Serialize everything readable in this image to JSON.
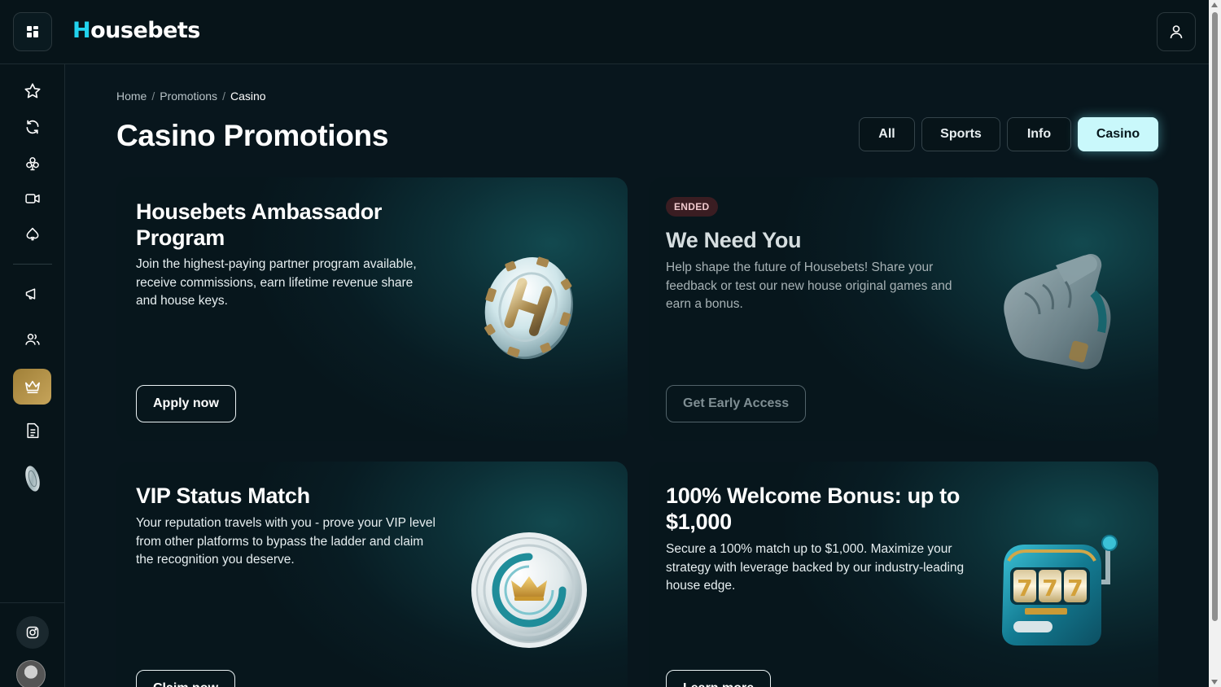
{
  "app": {
    "logo_first": "H",
    "logo_rest": "ousebets"
  },
  "breadcrumb": {
    "home": "Home",
    "sep1": "/",
    "promotions": "Promotions",
    "sep2": "/",
    "current": "Casino"
  },
  "page": {
    "title": "Casino Promotions"
  },
  "filters": [
    {
      "label": "All",
      "active": false
    },
    {
      "label": "Sports",
      "active": false
    },
    {
      "label": "Info",
      "active": false
    },
    {
      "label": "Casino",
      "active": true
    }
  ],
  "cards": [
    {
      "title": "Housebets Ambassador Program",
      "description": "Join the highest-paying partner program available, receive commissions, earn lifetime revenue share and house keys.",
      "button": "Apply now",
      "icon": "poker-chip-h-icon"
    },
    {
      "badge": "ENDED",
      "title": "We Need You",
      "description": "Help shape the future of Housebets! Share your feedback or test our new house original games and earn a bonus.",
      "button": "Get Early Access",
      "icon": "pointing-hand-icon"
    },
    {
      "title": "VIP Status Match",
      "description": "Your reputation travels with you - prove your VIP level from other platforms to bypass the ladder and claim the recognition you deserve.",
      "button": "Claim now",
      "icon": "crown-coin-icon"
    },
    {
      "title": "100% Welcome Bonus: up to $1,000",
      "description": "Secure a 100% match up to $1,000. Maximize your strategy with leverage backed by our industry-leading house edge.",
      "button": "Learn more",
      "icon": "slot-machine-icon"
    }
  ],
  "sidebar": {
    "items": [
      "star-icon",
      "refresh-icon",
      "club-icon",
      "video-icon",
      "spade-icon",
      "megaphone-icon",
      "users-icon",
      "crown-icon",
      "document-icon",
      "coin-icon"
    ],
    "active": "crown-icon"
  },
  "colors": {
    "accent": "#22d3ee",
    "active_filter": "#c9f8fb",
    "vip_gold": "#b8954a",
    "background": "#08161d"
  }
}
